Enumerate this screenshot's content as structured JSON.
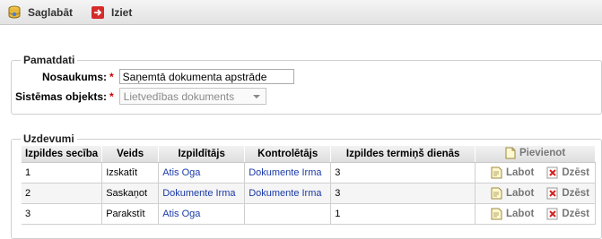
{
  "toolbar": {
    "save_label": "Saglabāt",
    "exit_label": "Iziet"
  },
  "general": {
    "legend": "Pamatdati",
    "name_label": "Nosaukums:",
    "name_value": "Saņemtā dokumenta apstrāde",
    "system_object_label": "Sistēmas objekts:",
    "system_object_value": "Lietvedības dokuments",
    "required_mark": "*"
  },
  "tasks": {
    "legend": "Uzdevumi",
    "add_label": "Pievienot",
    "edit_label": "Labot",
    "delete_label": "Dzēst",
    "columns": [
      "Izpildes secība",
      "Veids",
      "Izpildītājs",
      "Kontrolētājs",
      "Izpildes termiņš dienās"
    ],
    "rows": [
      {
        "order": "1",
        "type": "Izskatīt",
        "executor": "Atis Oga",
        "controller": "Dokumente Irma",
        "term": "3"
      },
      {
        "order": "2",
        "type": "Saskaņot",
        "executor": "Dokumente Irma",
        "controller": "Dokumente Irma",
        "term": "3"
      },
      {
        "order": "3",
        "type": "Parakstīt",
        "executor": "Atis Oga",
        "controller": "",
        "term": "1"
      }
    ]
  },
  "colors": {
    "link": "#1a3aa8",
    "required": "#cc0000",
    "delete_icon": "#d32020"
  },
  "icons": {
    "save": "database-save-icon",
    "exit": "exit-arrow-icon",
    "add": "add-document-icon",
    "edit": "edit-document-icon",
    "delete": "delete-icon"
  }
}
